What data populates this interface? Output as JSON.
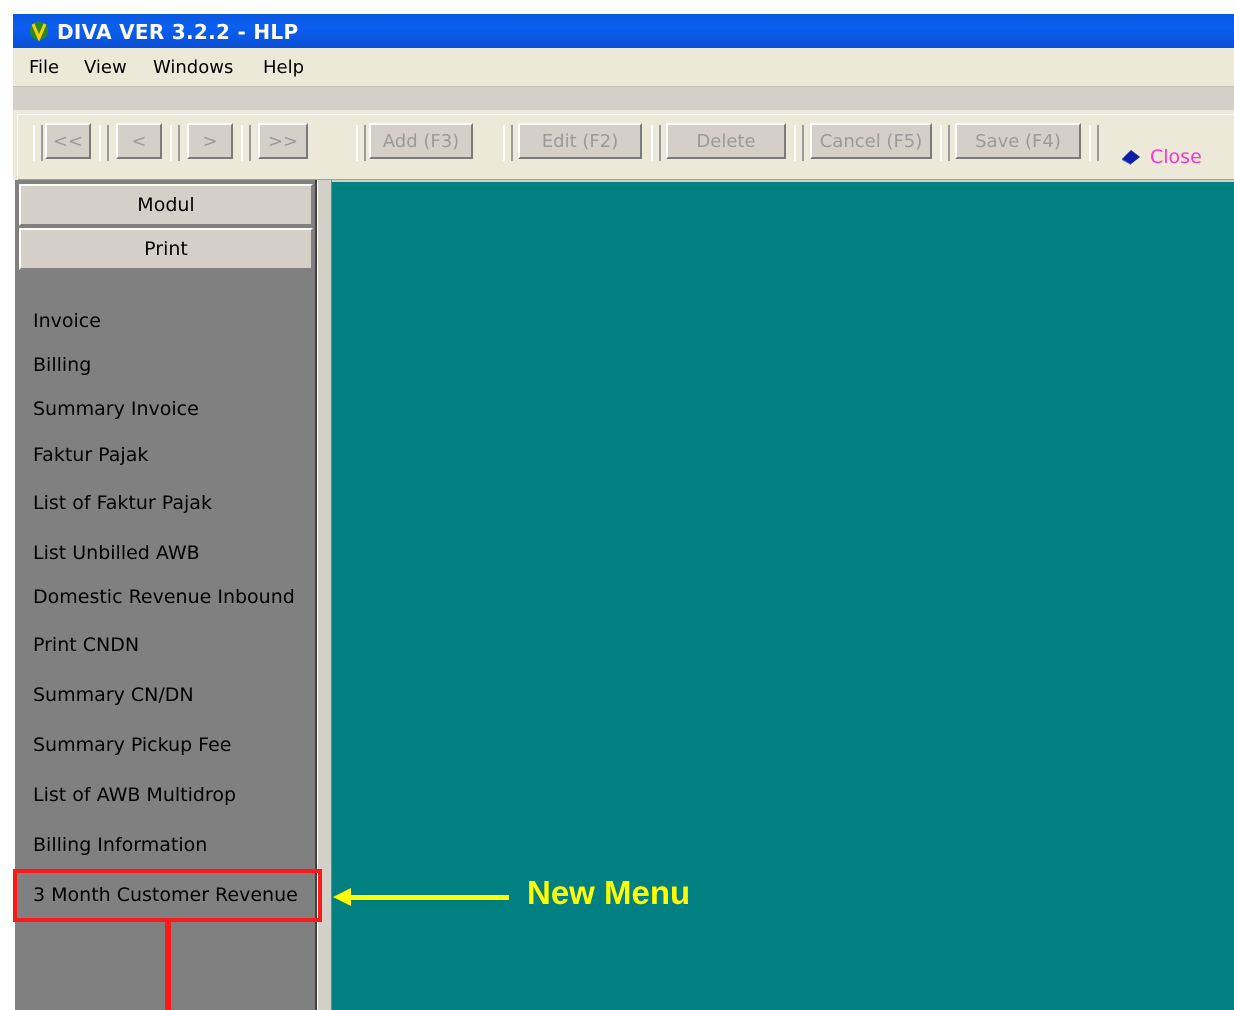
{
  "window": {
    "title": "DIVA VER 3.2.2 - HLP"
  },
  "menubar": {
    "items": [
      "File",
      "View",
      "Windows",
      "Help"
    ]
  },
  "toolbar": {
    "nav_first": "<<",
    "nav_prev": "<",
    "nav_next": ">",
    "nav_last": ">>",
    "add": "Add (F3)",
    "edit": "Edit (F2)",
    "delete": "Delete",
    "cancel": "Cancel (F5)",
    "save": "Save (F4)",
    "close": "Close"
  },
  "sidebar": {
    "modul_header": "Modul",
    "print_header": "Print",
    "items": [
      "Invoice",
      "Billing",
      "Summary Invoice",
      "Faktur Pajak",
      "List of Faktur Pajak",
      "List Unbilled AWB",
      "Domestic Revenue Inbound",
      "Print CNDN",
      "Summary CN/DN",
      "Summary Pickup Fee",
      "List of AWB Multidrop",
      "Billing Information",
      "3 Month Customer Revenue"
    ]
  },
  "annotation": {
    "label": "New Menu"
  },
  "colors": {
    "workspace": "#008080",
    "sidebar": "#808080",
    "highlight": "#ff1a1a",
    "annotation": "#ffff00",
    "close_text": "#ff33cc"
  }
}
